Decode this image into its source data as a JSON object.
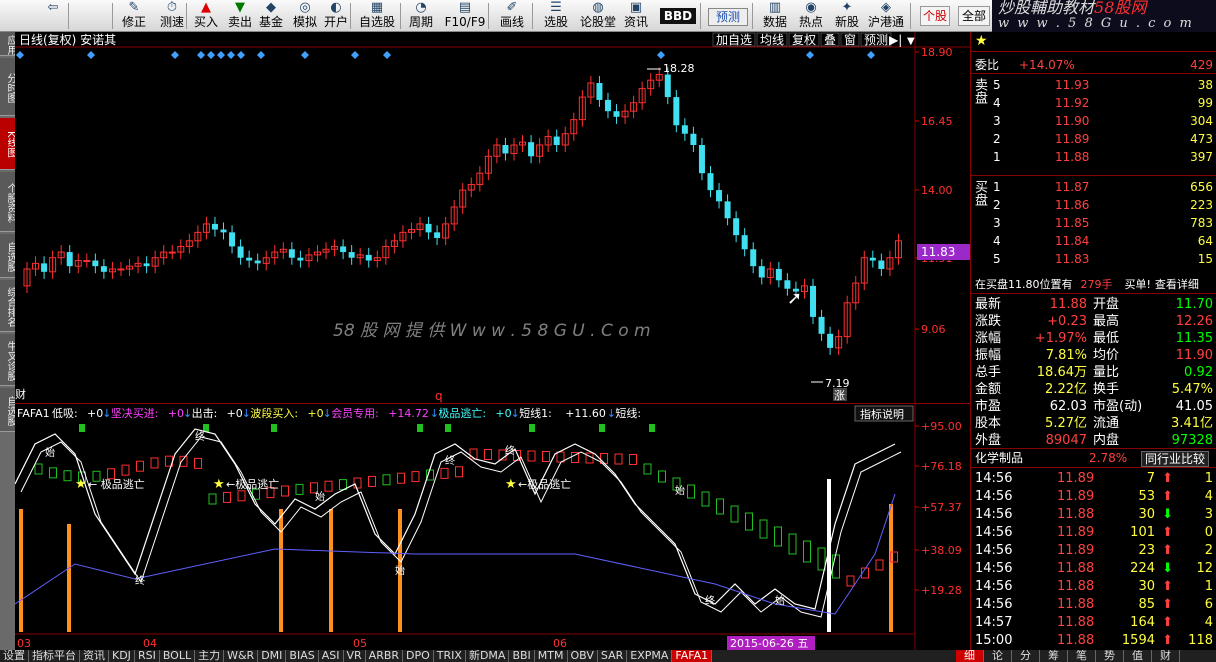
{
  "toolbar": {
    "items": [
      "",
      "修正",
      "测速",
      "买入",
      "卖出",
      "基金",
      "模拟",
      "开户",
      "自选股",
      "周期",
      "F10/F9",
      "画线",
      "选股",
      "论股堂",
      "资讯",
      "BBD",
      "预测",
      "数据",
      "热点",
      "新股",
      "沪港通",
      "个股",
      "全部"
    ],
    "selected": "个股"
  },
  "brand": {
    "line1_a": "炒股輔助教材",
    "line1_b": "58股网",
    "line2": "w w w . 5 8 G u . c o m"
  },
  "left_tabs": [
    "应用",
    "分时图",
    "K线图",
    "个股资料",
    "自选股",
    "综合排名",
    "牛叉诊股",
    "自选股"
  ],
  "left_active": 2,
  "main": {
    "title": "日线(复权) 安诺其",
    "buttons": [
      "加自选",
      "均线",
      "复权",
      "叠",
      "窗",
      "预测"
    ],
    "price_axis": [
      "18.90",
      "16.45",
      "14.00",
      "11.51",
      "9.06"
    ],
    "current_price": "11.83",
    "high_label": "18.28",
    "low_label": "7.19",
    "cai": "财",
    "q": "q",
    "zhang": "涨",
    "watermark": "58 股 网 提 供   W w w . 5 8 G U . C o m"
  },
  "indicator": {
    "legend": [
      {
        "t": "FAFA1",
        "c": "#ffffff"
      },
      {
        "t": "低吸:",
        "c": "#ffffff"
      },
      {
        "t": "+0",
        "c": "#ffffff"
      },
      {
        "t": "↓",
        "c": "#3090ff"
      },
      {
        "t": "坚决买进:",
        "c": "#ff40ff"
      },
      {
        "t": "+0",
        "c": "#ff40ff"
      },
      {
        "t": "↓",
        "c": "#3090ff"
      },
      {
        "t": "出击:",
        "c": "#ffffff"
      },
      {
        "t": "+0",
        "c": "#ffffff"
      },
      {
        "t": "↓",
        "c": "#3090ff"
      },
      {
        "t": "波段买入:",
        "c": "#ffff40"
      },
      {
        "t": "+0",
        "c": "#ffff40"
      },
      {
        "t": "↓",
        "c": "#3090ff"
      },
      {
        "t": "会员专用:",
        "c": "#ff40ff"
      },
      {
        "t": "+14.72",
        "c": "#ff40ff"
      },
      {
        "t": "↓",
        "c": "#3090ff"
      },
      {
        "t": "极品逃亡:",
        "c": "#40ffff"
      },
      {
        "t": "+0",
        "c": "#40ffff"
      },
      {
        "t": "↓",
        "c": "#3090ff"
      },
      {
        "t": "短线1:",
        "c": "#ffffff"
      },
      {
        "t": "+11.60",
        "c": "#ffffff"
      },
      {
        "t": "↓",
        "c": "#3090ff"
      },
      {
        "t": "短线:",
        "c": "#ffffff"
      }
    ],
    "help": "指标说明",
    "axis": [
      "+95.00",
      "+76.18",
      "+57.37",
      "+38.09",
      "+19.28"
    ],
    "months": [
      "03",
      "04",
      "05",
      "06"
    ],
    "date": "2015-06-26 五",
    "flags": [
      "← 极品逃亡",
      "←极品逃亡",
      "←极品逃亡"
    ],
    "marks": [
      "终",
      "始"
    ]
  },
  "orderbook": {
    "wb_label": "委比",
    "wb_pct": "+14.07%",
    "wb_val": "429",
    "sell_label": "卖盘",
    "buy_label": "买盘",
    "sells": [
      {
        "n": "5",
        "p": "11.93",
        "v": "38"
      },
      {
        "n": "4",
        "p": "11.92",
        "v": "99"
      },
      {
        "n": "3",
        "p": "11.90",
        "v": "304"
      },
      {
        "n": "2",
        "p": "11.89",
        "v": "473"
      },
      {
        "n": "1",
        "p": "11.88",
        "v": "397"
      }
    ],
    "buys": [
      {
        "n": "1",
        "p": "11.87",
        "v": "656"
      },
      {
        "n": "2",
        "p": "11.86",
        "v": "223"
      },
      {
        "n": "3",
        "p": "11.85",
        "v": "783"
      },
      {
        "n": "4",
        "p": "11.84",
        "v": "64"
      },
      {
        "n": "5",
        "p": "11.83",
        "v": "15"
      }
    ],
    "notice_a": "在买盘11.80位置有",
    "notice_b": "279手",
    "notice_c": "买单!",
    "notice_d": "查看详细"
  },
  "stats": [
    {
      "a": "最新",
      "av": "11.88",
      "b": "开盘",
      "bv": "11.70",
      "ac": "r",
      "bc": "g"
    },
    {
      "a": "涨跌",
      "av": "+0.23",
      "b": "最高",
      "bv": "12.26",
      "ac": "r",
      "bc": "r"
    },
    {
      "a": "涨幅",
      "av": "+1.97%",
      "b": "最低",
      "bv": "11.35",
      "ac": "r",
      "bc": "g"
    },
    {
      "a": "振幅",
      "av": "7.81%",
      "b": "均价",
      "bv": "11.90",
      "ac": "y",
      "bc": "r"
    },
    {
      "a": "总手",
      "av": "18.64万",
      "b": "量比",
      "bv": "0.92",
      "ac": "y",
      "bc": "g"
    },
    {
      "a": "金额",
      "av": "2.22亿",
      "b": "换手",
      "bv": "5.47%",
      "ac": "y",
      "bc": "y"
    },
    {
      "a": "市盈",
      "av": "62.03",
      "b": "市盈(动)",
      "bv": "41.05",
      "ac": "w",
      "bc": "w"
    },
    {
      "a": "股本",
      "av": "5.27亿",
      "b": "流通",
      "bv": "3.41亿",
      "ac": "y",
      "bc": "y"
    },
    {
      "a": "外盘",
      "av": "89047",
      "b": "内盘",
      "bv": "97328",
      "ac": "r",
      "bc": "g"
    }
  ],
  "industry": {
    "name": "化学制品",
    "pct": "2.78%",
    "btn": "同行业比较"
  },
  "ticks": [
    {
      "t": "14:56",
      "p": "11.89",
      "v": "7",
      "d": "up",
      "n": "1"
    },
    {
      "t": "14:56",
      "p": "11.89",
      "v": "53",
      "d": "up",
      "n": "4"
    },
    {
      "t": "14:56",
      "p": "11.88",
      "v": "30",
      "d": "down",
      "n": "3"
    },
    {
      "t": "14:56",
      "p": "11.89",
      "v": "101",
      "d": "up",
      "n": "0"
    },
    {
      "t": "14:56",
      "p": "11.89",
      "v": "23",
      "d": "up",
      "n": "2"
    },
    {
      "t": "14:56",
      "p": "11.88",
      "v": "224",
      "d": "down",
      "n": "12"
    },
    {
      "t": "14:56",
      "p": "11.88",
      "v": "30",
      "d": "up",
      "n": "1"
    },
    {
      "t": "14:56",
      "p": "11.88",
      "v": "85",
      "d": "up",
      "n": "6"
    },
    {
      "t": "14:57",
      "p": "11.88",
      "v": "164",
      "d": "up",
      "n": "4"
    },
    {
      "t": "15:00",
      "p": "11.88",
      "v": "1594",
      "d": "up",
      "n": "118"
    }
  ],
  "bottom_tabs": [
    "设置",
    "指标平台",
    "资讯",
    "KDJ",
    "RSI",
    "BOLL",
    "主力",
    "W&R",
    "DMI",
    "BIAS",
    "ASI",
    "VR",
    "ARBR",
    "DPO",
    "TRIX",
    "新DMA",
    "BBI",
    "MTM",
    "OBV",
    "SAR",
    "EXPMA",
    "FAFA1"
  ],
  "bottom_sel": "FAFA1",
  "right_tabs": [
    "细",
    "论",
    "分",
    "筹",
    "笔",
    "势",
    "值",
    "财"
  ],
  "colors": {
    "up": "#ff3030",
    "down": "#40e0f0",
    "panel_border": "#800000"
  }
}
